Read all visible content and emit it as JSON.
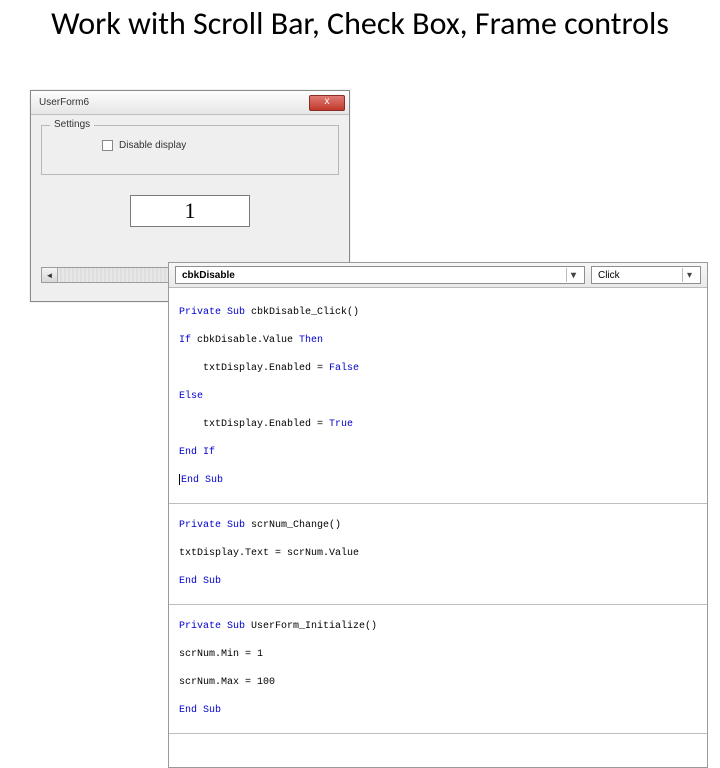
{
  "slide": {
    "title": "Work with Scroll Bar, Check Box, Frame controls"
  },
  "userform": {
    "title": "UserForm6",
    "close_glyph": "x",
    "frame_caption": "Settings",
    "checkbox_label": "Disable display",
    "display_value": "1",
    "scroll_left_glyph": "◄",
    "scroll_right_glyph": "►"
  },
  "editor": {
    "object_combo": "cbkDisable",
    "proc_combo": "Click",
    "caret_glyph": "▾",
    "code": {
      "sub1_decl_a": "Private Sub",
      "sub1_decl_b": " cbkDisable_Click()",
      "l2a": "If",
      "l2b": " cbkDisable.Value ",
      "l2c": "Then",
      "l3": "    txtDisplay.Enabled = ",
      "l3b": "False",
      "l4": "Else",
      "l5": "    txtDisplay.Enabled = ",
      "l5b": "True",
      "l6": "End If",
      "l7": "End Sub",
      "sub2_decl_a": "Private Sub",
      "sub2_decl_b": " scrNum_Change()",
      "l9": "txtDisplay.Text = scrNum.Value",
      "l10": "End Sub",
      "sub3_decl_a": "Private Sub",
      "sub3_decl_b": " UserForm_Initialize()",
      "l12": "scrNum.Min = 1",
      "l13": "scrNum.Max = 100",
      "l14": "End Sub"
    }
  }
}
